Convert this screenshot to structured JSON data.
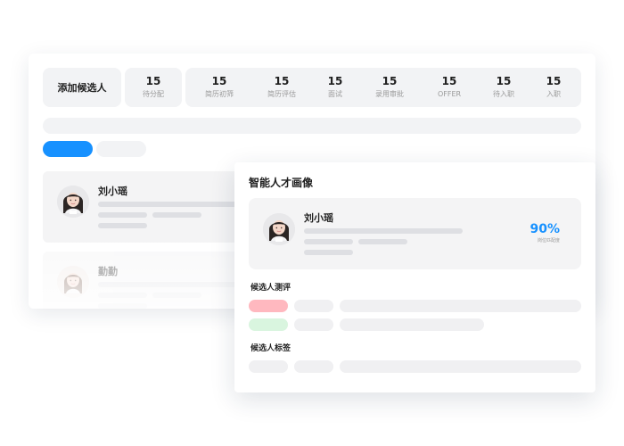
{
  "toolbar": {
    "add_candidate_label": "添加候选人"
  },
  "pipeline": {
    "stages": [
      {
        "count": "15",
        "label": "待分配"
      },
      {
        "count": "15",
        "label": "简历初筛"
      },
      {
        "count": "15",
        "label": "简历评估"
      },
      {
        "count": "15",
        "label": "面试"
      },
      {
        "count": "15",
        "label": "录用审批"
      },
      {
        "count": "15",
        "label": "OFFER"
      },
      {
        "count": "15",
        "label": "待入职"
      },
      {
        "count": "15",
        "label": "入职"
      }
    ]
  },
  "candidate_list": [
    {
      "name": "刘小瑶"
    },
    {
      "name": "勤勤"
    }
  ],
  "talent_profile": {
    "title": "智能人才画像",
    "candidate_name": "刘小瑶",
    "match_value": "90%",
    "match_label": "岗位匹配度",
    "assessment_title": "候选人测评",
    "tags_title": "候选人标签"
  },
  "colors": {
    "accent": "#1791ff",
    "chip_red": "#ffb8bf",
    "chip_green": "#d9f5df"
  },
  "icons": {
    "avatar_1": "female-avatar-icon",
    "avatar_2": "female-avatar-icon"
  }
}
